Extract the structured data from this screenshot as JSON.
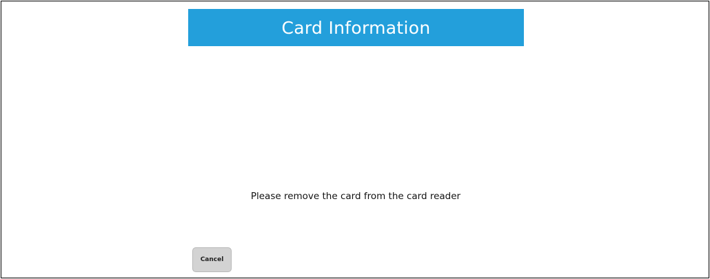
{
  "header": {
    "title": "Card Information",
    "background_color": "#239fdb"
  },
  "main": {
    "message": "Please remove the card from the card reader"
  },
  "actions": {
    "cancel_label": "Cancel"
  }
}
